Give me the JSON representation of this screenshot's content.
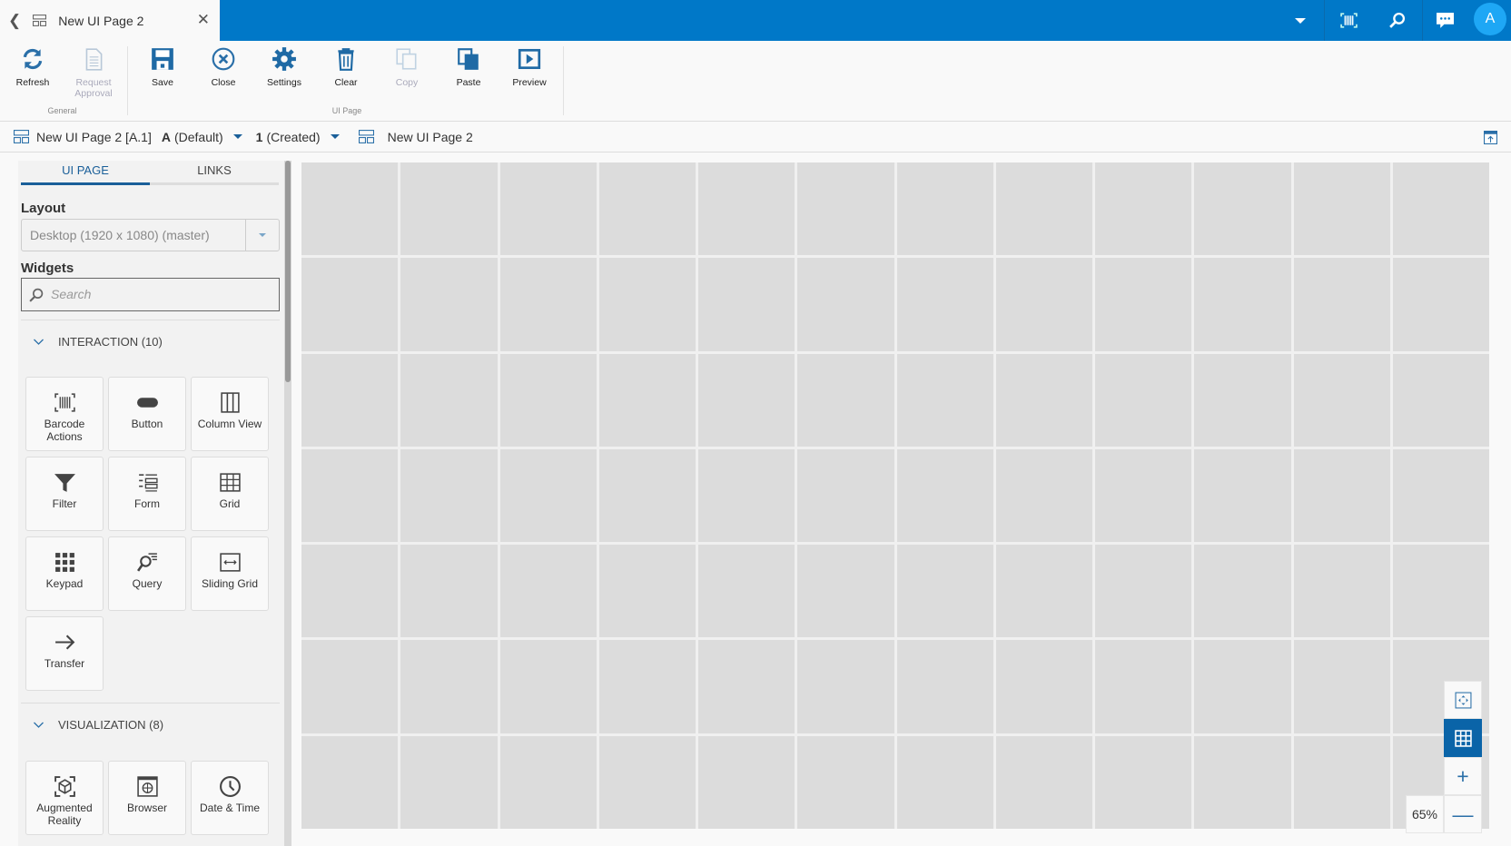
{
  "tab": {
    "title": "New UI Page 2"
  },
  "header": {
    "avatar": "A",
    "icons": [
      "chevron-down-icon",
      "barcode-icon",
      "search-icon",
      "chat-icon"
    ]
  },
  "ribbon": {
    "buttons": [
      {
        "label": "Refresh",
        "enabled": true
      },
      {
        "label": "Request Approval",
        "enabled": false
      },
      {
        "label": "Save",
        "enabled": true
      },
      {
        "label": "Close",
        "enabled": true
      },
      {
        "label": "Settings",
        "enabled": true
      },
      {
        "label": "Clear",
        "enabled": true
      },
      {
        "label": "Copy",
        "enabled": false
      },
      {
        "label": "Paste",
        "enabled": true
      },
      {
        "label": "Preview",
        "enabled": true
      }
    ],
    "groups": [
      "General",
      "UI Page"
    ]
  },
  "breadcrumb": {
    "page": "New UI Page 2 [A.1]",
    "rev_letter": "A",
    "rev_label": "(Default)",
    "ver_num": "1",
    "ver_label": "(Created)",
    "name": "New UI Page 2"
  },
  "sidebar": {
    "tabs": [
      "UI PAGE",
      "LINKS"
    ],
    "layout_label": "Layout",
    "layout_value": "Desktop (1920 x 1080) (master)",
    "widgets_label": "Widgets",
    "search_placeholder": "Search",
    "sections": [
      {
        "title": "INTERACTION (10)",
        "items": [
          "Barcode Actions",
          "Button",
          "Column View",
          "Filter",
          "Form",
          "Grid",
          "Keypad",
          "Query",
          "Sliding Grid",
          "Transfer"
        ]
      },
      {
        "title": "VISUALIZATION (8)",
        "items": [
          "Augmented Reality",
          "Browser",
          "Date & Time"
        ]
      }
    ]
  },
  "canvas": {
    "columns": 12,
    "rows": 7
  },
  "zoom": {
    "level": "65%"
  },
  "colors": {
    "brand": "#0078c8",
    "accent": "#1a5f99"
  }
}
